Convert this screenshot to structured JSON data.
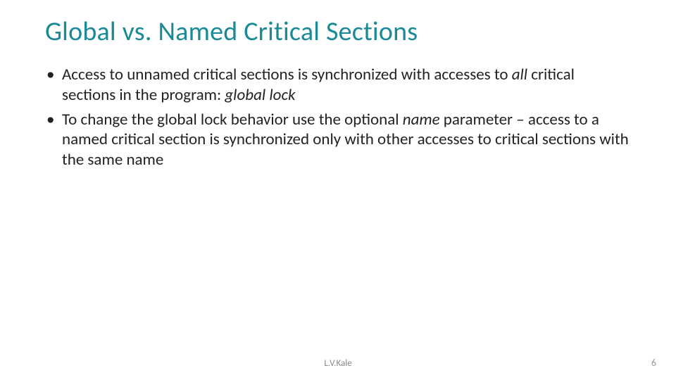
{
  "title": "Global vs. Named Critical Sections",
  "b1": {
    "t1": "Access to unnamed critical sections is synchronized with accesses to ",
    "it1": "all",
    "t2": " critical sections in the program: ",
    "it2": "global lock"
  },
  "b2": {
    "t1": "To change the global lock behavior use the optional ",
    "it1": "name",
    "t2": " parameter – access to a named critical section is synchronized only with other accesses to critical sections with the same name"
  },
  "footer": {
    "author": "L.V.Kale",
    "page": "6"
  }
}
